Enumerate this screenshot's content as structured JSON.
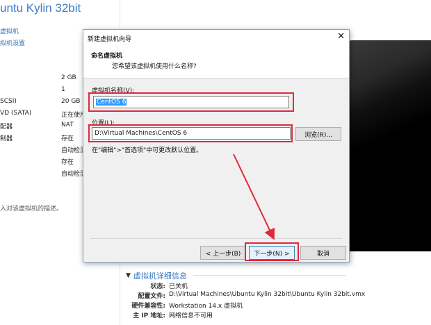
{
  "window": {
    "title": "untu Kylin 32bit"
  },
  "sidebar": {
    "links": [
      "虚拟机",
      "拟机设置"
    ]
  },
  "devices": {
    "names": [
      "SCSI)",
      "VD (SATA)",
      "配器",
      "制器"
    ],
    "values": [
      "2 GB",
      "1",
      "20 GB",
      "正在使用",
      "NAT",
      "存在",
      "自动检测",
      "存在",
      "自动检测"
    ],
    "description_hint": "入对该虚拟机的描述。"
  },
  "details": {
    "header": "虚拟机详细信息",
    "rows": [
      {
        "key": "状态:",
        "value": "已关机"
      },
      {
        "key": "配置文件:",
        "value": "D:\\Virtual Machines\\Ubuntu Kylin 32bit\\Ubuntu Kylin 32bit.vmx"
      },
      {
        "key": "硬件兼容性:",
        "value": "Workstation 14.x 虚拟机"
      },
      {
        "key": "主 IP 地址:",
        "value": "网络信息不可用"
      }
    ]
  },
  "dialog": {
    "title": "新建虚拟机向导",
    "close": "✕",
    "header_title": "命名虚拟机",
    "header_subtitle": "您希望该虚拟机使用什么名称?",
    "name_label": "虚拟机名称(V):",
    "name_value": "CentOS 6",
    "location_label": "位置(L):",
    "location_value": "D:\\Virtual Machines\\CentOS 6",
    "browse_button": "浏览(R)...",
    "hint": "在\"编辑\">\"首选项\"中可更改默认位置。",
    "back_button": "< 上一步(B)",
    "next_button": "下一步(N) >",
    "cancel_button": "取消"
  },
  "colors": {
    "annotation": "#e2283a",
    "link": "#3575c2",
    "selection": "#3399ff"
  }
}
